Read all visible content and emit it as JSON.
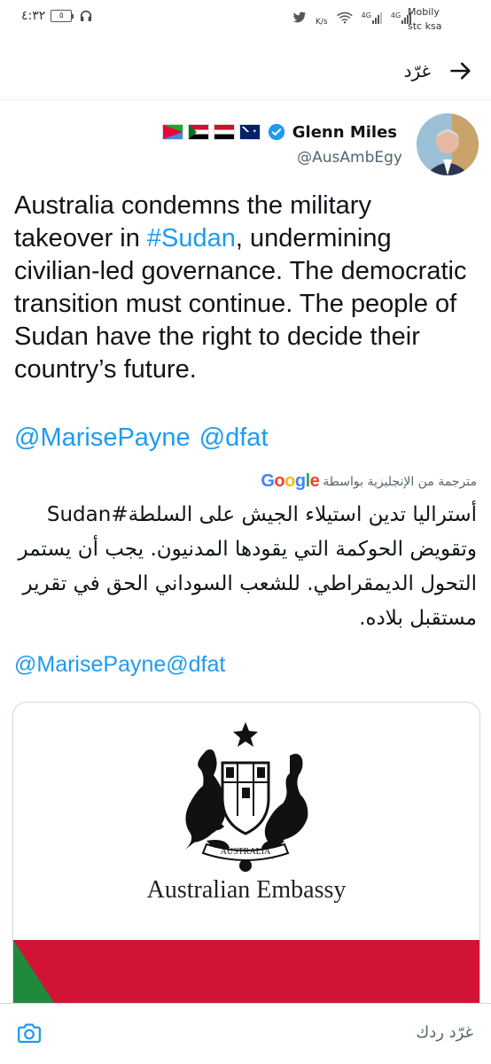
{
  "status_bar": {
    "time": "٤:٣٢",
    "battery": "٥",
    "carrier_line1": "Mobily",
    "carrier_line2": "stc ksa",
    "speed": "K/s",
    "network1": "4G",
    "network2": "4G"
  },
  "header": {
    "title": "غرّد"
  },
  "tweet": {
    "author_name": "Glenn Miles",
    "handle": "@AusAmbEgy",
    "flags": [
      "australia-flag",
      "egypt-flag",
      "sudan-flag",
      "eritrea-flag"
    ],
    "text_before": "Australia condemns the military takeover in ",
    "hashtag": "#Sudan",
    "text_after": ", undermining civilian-led governance. The democratic transition must continue. The people of Sudan have the right to decide their country’s future.",
    "mention1": "@MarisePayne",
    "mention2": "@dfat",
    "translated_by": "مترجمة من الإنجليزية بواسطة",
    "google_logo": "Google",
    "arabic_text": "أستراليا تدين استيلاء الجيش على السلطة#Sudan وتقويض الحوكمة التي يقودها المدنيون. يجب أن يستمر التحول الديمقراطي. للشعب السوداني الحق في تقرير مستقبل بلاده.",
    "mentions_translated": "@MarisePayne@dfat"
  },
  "image_card": {
    "caption": "Australian Embassy",
    "crest_scroll": "AUSTRALIA"
  },
  "bottom_bar": {
    "reply_placeholder": "غرّد ردك"
  },
  "colors": {
    "link": "#1d9bf0",
    "verified": "#1d9bf0",
    "muted": "#536471"
  }
}
